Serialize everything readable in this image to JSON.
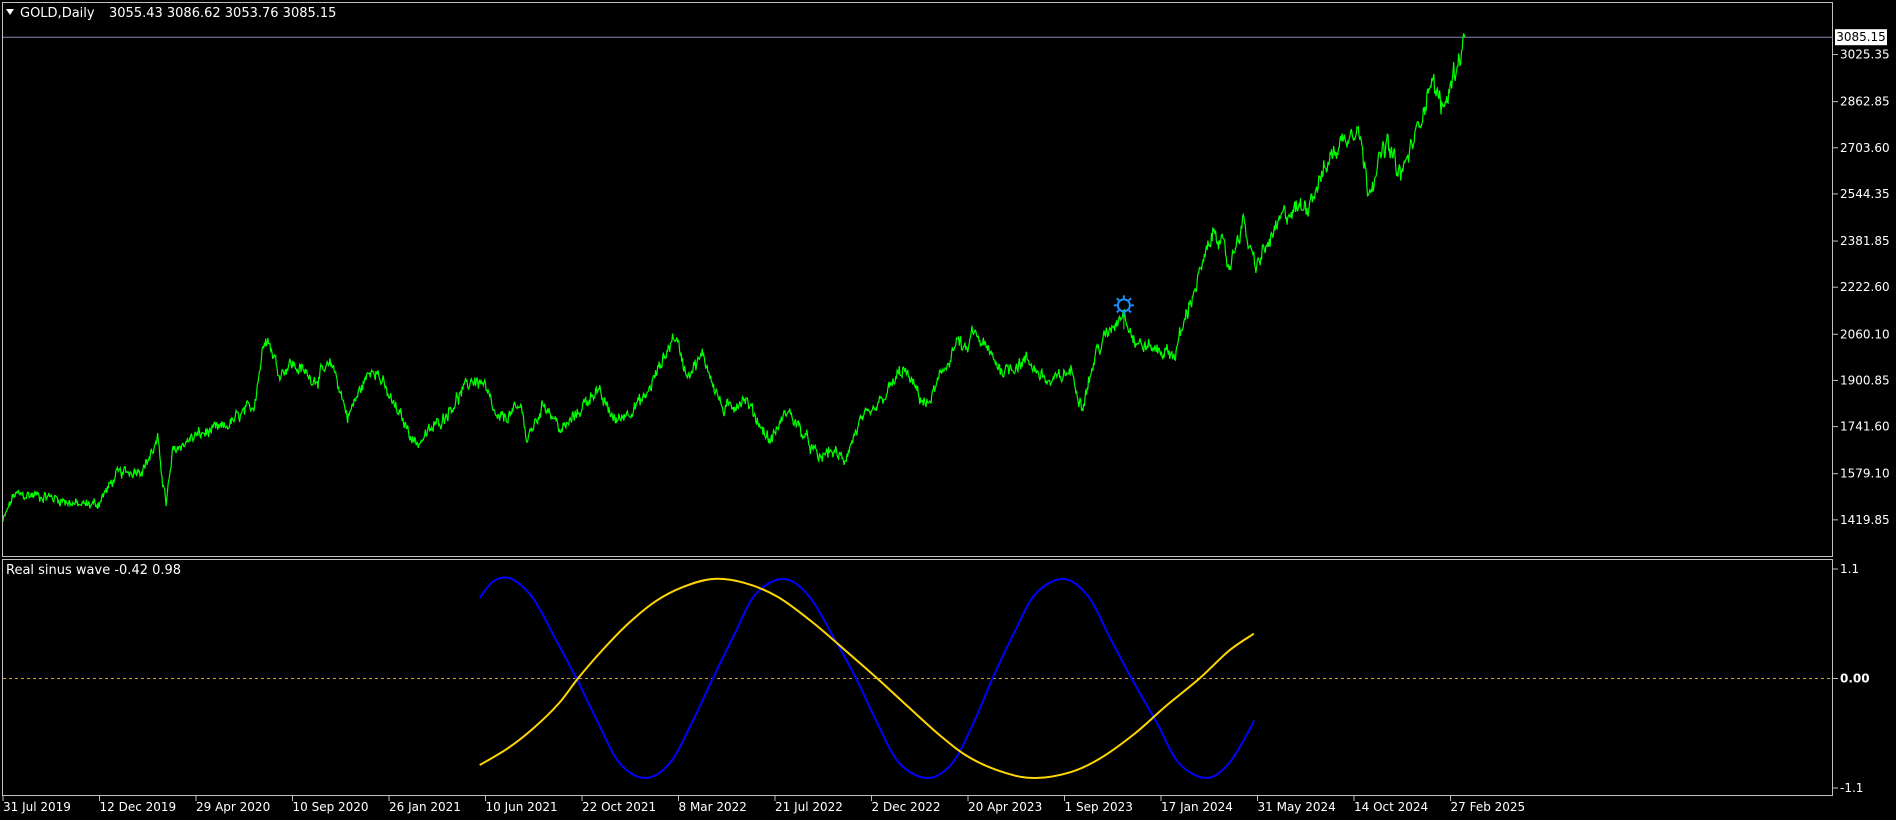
{
  "main_panel": {
    "symbol": "GOLD,Daily",
    "ohlc": "3055.43 3086.62 3053.76 3085.15",
    "current_price_label": "3085.15",
    "y_tick_labels": [
      "3025.35",
      "2862.85",
      "2703.60",
      "2544.35",
      "2381.85",
      "2222.60",
      "2060.10",
      "1900.85",
      "1741.60",
      "1579.10",
      "1419.85"
    ]
  },
  "sub_panel": {
    "title": "Real sinus wave -0.42 0.98",
    "y_tick_labels": [
      "1.1",
      "0.00",
      "-1.1"
    ]
  },
  "x_tick_labels": [
    "31 Jul 2019",
    "12 Dec 2019",
    "29 Apr 2020",
    "10 Sep 2020",
    "26 Jan 2021",
    "10 Jun 2021",
    "22 Oct 2021",
    "8 Mar 2022",
    "21 Jul 2022",
    "2 Dec 2022",
    "20 Apr 2023",
    "1 Sep 2023",
    "17 Jan 2024",
    "31 May 2024",
    "14 Oct 2024",
    "27 Feb 2025"
  ],
  "colors": {
    "background": "#000000",
    "price_line": "#00ff00",
    "axis_text": "#ffffff",
    "frame": "#c0c0c0",
    "current_price_line": "#8a8ab0",
    "blue_wave": "#0000ff",
    "gold_wave": "#ffd700",
    "zero_level": "#d4a017",
    "event_marker": "#1e90ff"
  },
  "chart_data": [
    {
      "type": "line",
      "title": "GOLD,Daily",
      "x_axis": "date",
      "ylim": [
        1340,
        3110
      ],
      "series": [
        {
          "name": "GOLD",
          "points": [
            [
              "2019-07-31",
              1413
            ],
            [
              "2019-08-15",
              1505
            ],
            [
              "2019-09-15",
              1505
            ],
            [
              "2019-10-15",
              1495
            ],
            [
              "2019-11-15",
              1470
            ],
            [
              "2019-12-12",
              1475
            ],
            [
              "2020-01-08",
              1575
            ],
            [
              "2020-02-15",
              1600
            ],
            [
              "2020-03-06",
              1690
            ],
            [
              "2020-03-18",
              1475
            ],
            [
              "2020-03-28",
              1660
            ],
            [
              "2020-04-29",
              1710
            ],
            [
              "2020-06-10",
              1740
            ],
            [
              "2020-07-20",
              1815
            ],
            [
              "2020-08-06",
              2070
            ],
            [
              "2020-08-25",
              1925
            ],
            [
              "2020-09-10",
              1960
            ],
            [
              "2020-10-15",
              1905
            ],
            [
              "2020-11-09",
              1955
            ],
            [
              "2020-11-30",
              1775
            ],
            [
              "2020-12-20",
              1880
            ],
            [
              "2021-01-06",
              1955
            ],
            [
              "2021-01-26",
              1850
            ],
            [
              "2021-03-08",
              1680
            ],
            [
              "2021-04-15",
              1775
            ],
            [
              "2021-05-25",
              1905
            ],
            [
              "2021-06-10",
              1890
            ],
            [
              "2021-06-30",
              1760
            ],
            [
              "2021-08-05",
              1810
            ],
            [
              "2021-08-10",
              1690
            ],
            [
              "2021-09-05",
              1825
            ],
            [
              "2021-09-29",
              1725
            ],
            [
              "2021-10-22",
              1790
            ],
            [
              "2021-11-16",
              1870
            ],
            [
              "2021-12-15",
              1760
            ],
            [
              "2022-01-25",
              1840
            ],
            [
              "2022-03-08",
              2060
            ],
            [
              "2022-03-25",
              1925
            ],
            [
              "2022-04-18",
              1985
            ],
            [
              "2022-05-16",
              1795
            ],
            [
              "2022-06-15",
              1840
            ],
            [
              "2022-07-21",
              1690
            ],
            [
              "2022-08-15",
              1800
            ],
            [
              "2022-09-28",
              1630
            ],
            [
              "2022-10-15",
              1660
            ],
            [
              "2022-11-03",
              1625
            ],
            [
              "2022-11-25",
              1755
            ],
            [
              "2022-12-15",
              1790
            ],
            [
              "2023-01-25",
              1940
            ],
            [
              "2023-02-28",
              1810
            ],
            [
              "2023-04-13",
              2040
            ],
            [
              "2023-04-25",
              1990
            ],
            [
              "2023-05-04",
              2070
            ],
            [
              "2023-06-15",
              1935
            ],
            [
              "2023-07-20",
              1970
            ],
            [
              "2023-08-21",
              1890
            ],
            [
              "2023-09-20",
              1935
            ],
            [
              "2023-10-06",
              1815
            ],
            [
              "2023-10-27",
              2005
            ],
            [
              "2023-12-04",
              2145
            ],
            [
              "2023-12-20",
              2030
            ],
            [
              "2024-01-17",
              2010
            ],
            [
              "2024-02-14",
              1990
            ],
            [
              "2024-03-08",
              2180
            ],
            [
              "2024-04-12",
              2430
            ],
            [
              "2024-05-01",
              2290
            ],
            [
              "2024-05-20",
              2450
            ],
            [
              "2024-06-07",
              2290
            ],
            [
              "2024-07-17",
              2470
            ],
            [
              "2024-08-20",
              2510
            ],
            [
              "2024-09-26",
              2690
            ],
            [
              "2024-10-30",
              2790
            ],
            [
              "2024-11-14",
              2560
            ],
            [
              "2024-12-10",
              2720
            ],
            [
              "2024-12-30",
              2605
            ],
            [
              "2025-01-22",
              2760
            ],
            [
              "2025-02-11",
              2940
            ],
            [
              "2025-02-28",
              2835
            ],
            [
              "2025-03-31",
              3085.15
            ]
          ]
        }
      ],
      "event_marker": {
        "x": "2023-12-04",
        "y": 2160
      }
    },
    {
      "type": "line",
      "title": "Real sinus wave -0.42 0.98",
      "x_axis": "date",
      "ylim": [
        -1.1,
        1.1
      ],
      "reference_line": 0.0,
      "series": [
        {
          "color": "#0000ff",
          "points": [
            [
              "2021-06-05",
              0.81
            ],
            [
              "2021-06-25",
              0.98
            ],
            [
              "2021-07-20",
              1.0
            ],
            [
              "2021-08-20",
              0.8
            ],
            [
              "2021-09-20",
              0.4
            ],
            [
              "2021-10-20",
              0.0
            ],
            [
              "2021-11-20",
              -0.45
            ],
            [
              "2021-12-20",
              -0.85
            ],
            [
              "2022-01-25",
              -1.0
            ],
            [
              "2022-03-01",
              -0.85
            ],
            [
              "2022-04-01",
              -0.45
            ],
            [
              "2022-05-01",
              0.0
            ],
            [
              "2022-06-01",
              0.45
            ],
            [
              "2022-07-01",
              0.85
            ],
            [
              "2022-08-10",
              1.0
            ],
            [
              "2022-09-15",
              0.82
            ],
            [
              "2022-10-20",
              0.4
            ],
            [
              "2022-11-20",
              0.0
            ],
            [
              "2022-12-20",
              -0.45
            ],
            [
              "2023-01-20",
              -0.85
            ],
            [
              "2023-03-01",
              -1.0
            ],
            [
              "2023-04-05",
              -0.85
            ],
            [
              "2023-05-05",
              -0.45
            ],
            [
              "2023-06-01",
              0.0
            ],
            [
              "2023-07-01",
              0.45
            ],
            [
              "2023-08-01",
              0.85
            ],
            [
              "2023-09-10",
              1.0
            ],
            [
              "2023-10-15",
              0.82
            ],
            [
              "2023-11-15",
              0.4
            ],
            [
              "2023-12-15",
              0.0
            ],
            [
              "2024-01-20",
              -0.45
            ],
            [
              "2024-02-20",
              -0.85
            ],
            [
              "2024-03-30",
              -1.0
            ],
            [
              "2024-05-01",
              -0.85
            ],
            [
              "2024-05-31",
              -0.5
            ],
            [
              "2024-06-05",
              -0.42
            ]
          ]
        },
        {
          "color": "#ffd700",
          "points": [
            [
              "2021-06-05",
              -0.87
            ],
            [
              "2021-07-15",
              -0.7
            ],
            [
              "2021-08-20",
              -0.5
            ],
            [
              "2021-09-25",
              -0.25
            ],
            [
              "2021-10-22",
              0.0
            ],
            [
              "2021-11-25",
              0.28
            ],
            [
              "2022-01-01",
              0.55
            ],
            [
              "2022-02-10",
              0.78
            ],
            [
              "2022-03-20",
              0.92
            ],
            [
              "2022-05-01",
              1.0
            ],
            [
              "2022-06-15",
              0.96
            ],
            [
              "2022-08-01",
              0.82
            ],
            [
              "2022-09-20",
              0.56
            ],
            [
              "2022-11-05",
              0.28
            ],
            [
              "2022-12-20",
              0.0
            ],
            [
              "2023-02-01",
              -0.28
            ],
            [
              "2023-03-20",
              -0.58
            ],
            [
              "2023-05-01",
              -0.8
            ],
            [
              "2023-06-20",
              -0.95
            ],
            [
              "2023-08-01",
              -1.0
            ],
            [
              "2023-09-20",
              -0.94
            ],
            [
              "2023-11-01",
              -0.8
            ],
            [
              "2023-12-20",
              -0.55
            ],
            [
              "2024-02-01",
              -0.28
            ],
            [
              "2024-03-20",
              0.0
            ],
            [
              "2024-05-01",
              0.28
            ],
            [
              "2024-06-05",
              0.45
            ]
          ]
        }
      ]
    }
  ]
}
